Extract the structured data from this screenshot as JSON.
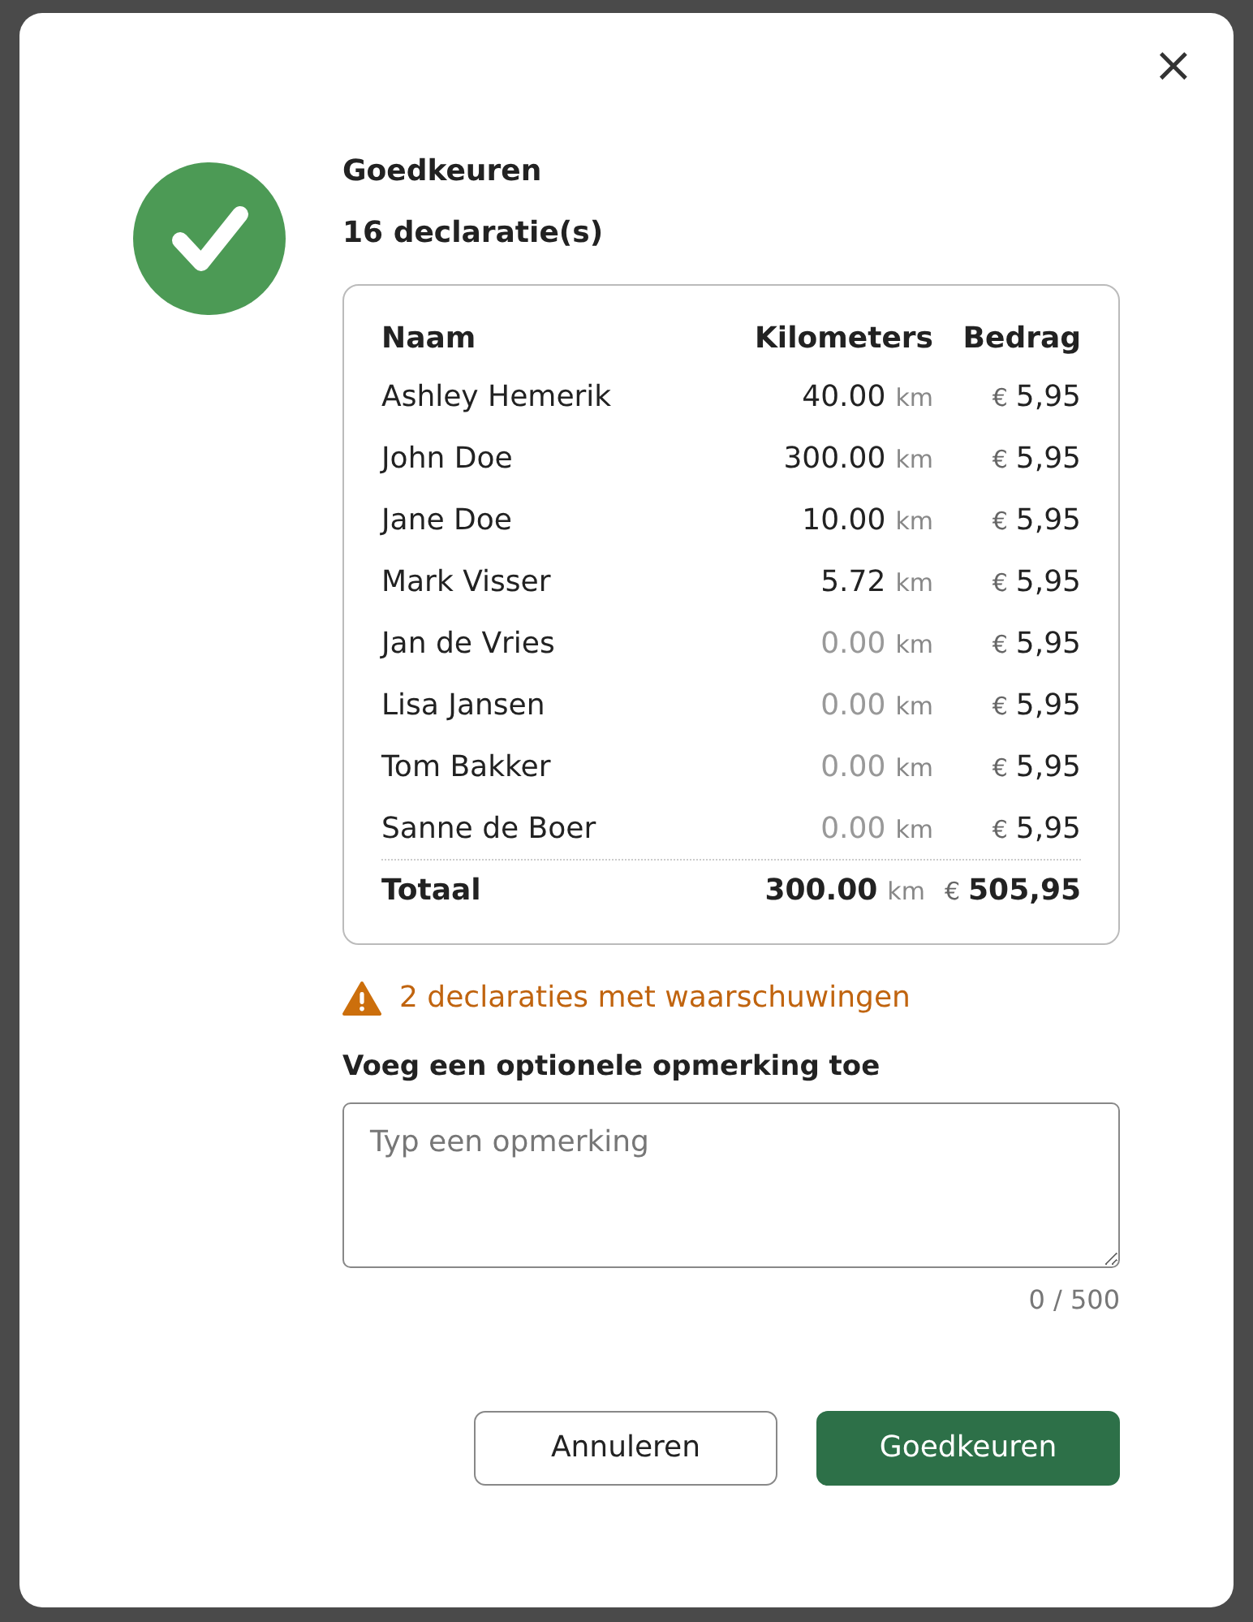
{
  "dialog": {
    "title": "Goedkeuren",
    "subtitle": "16 declaratie(s)",
    "close": "×"
  },
  "table": {
    "columns": [
      "Naam",
      "Kilometers",
      "Bedrag"
    ],
    "rows": [
      {
        "name": "Ashley Hemerik",
        "km": "40.00",
        "unit": "km",
        "currency": "€",
        "amount": "5,95",
        "dimmed": false
      },
      {
        "name": "John Doe",
        "km": "300.00",
        "unit": "km",
        "currency": "€",
        "amount": "5,95",
        "dimmed": false
      },
      {
        "name": "Jane Doe",
        "km": "10.00",
        "unit": "km",
        "currency": "€",
        "amount": "5,95",
        "dimmed": false
      },
      {
        "name": "Mark Visser",
        "km": "5.72",
        "unit": "km",
        "currency": "€",
        "amount": "5,95",
        "dimmed": false
      },
      {
        "name": "Jan de Vries",
        "km": "0.00",
        "unit": "km",
        "currency": "€",
        "amount": "5,95",
        "dimmed": true
      },
      {
        "name": "Lisa Jansen",
        "km": "0.00",
        "unit": "km",
        "currency": "€",
        "amount": "5,95",
        "dimmed": true
      },
      {
        "name": "Tom Bakker",
        "km": "0.00",
        "unit": "km",
        "currency": "€",
        "amount": "5,95",
        "dimmed": true
      },
      {
        "name": "Sanne de Boer",
        "km": "0.00",
        "unit": "km",
        "currency": "€",
        "amount": "5,95",
        "dimmed": true
      }
    ],
    "total": {
      "label": "Totaal",
      "km": "300.00",
      "unit": "km",
      "currency": "€",
      "amount": "505,95"
    }
  },
  "warning": "2 declaraties met waarschuwingen",
  "comment": {
    "label": "Voeg een optionele opmerking toe",
    "placeholder": "Typ een opmerking",
    "counter": "0 / 500"
  },
  "buttons": [
    {
      "label": "Annuleren",
      "kind": "secondary"
    },
    {
      "label": "Goedkeuren",
      "kind": "primary"
    }
  ]
}
